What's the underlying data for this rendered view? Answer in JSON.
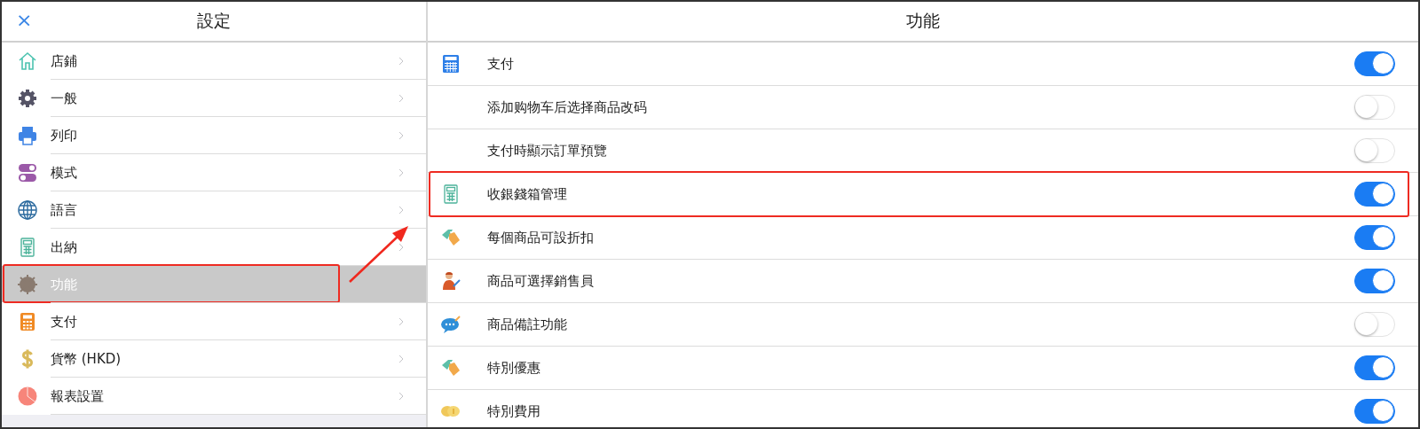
{
  "settings_panel": {
    "close": "×",
    "title": "設定",
    "items": [
      {
        "label": "店鋪",
        "selected": false,
        "outlined": false
      },
      {
        "label": "一般",
        "selected": false,
        "outlined": false
      },
      {
        "label": "列印",
        "selected": false,
        "outlined": false
      },
      {
        "label": "模式",
        "selected": false,
        "outlined": false
      },
      {
        "label": "語言",
        "selected": false,
        "outlined": false
      },
      {
        "label": "出納",
        "selected": false,
        "outlined": false
      },
      {
        "label": "功能",
        "selected": true,
        "outlined": true
      },
      {
        "label": "支付",
        "selected": false,
        "outlined": false
      },
      {
        "label": "貨幣 (HKD)",
        "selected": false,
        "outlined": false
      },
      {
        "label": "報表設置",
        "selected": false,
        "outlined": false
      }
    ]
  },
  "feature_panel": {
    "title": "功能",
    "rows": [
      {
        "label": "支付",
        "on": true,
        "outlined": false
      },
      {
        "label": "添加购物车后选择商品改码",
        "on": false,
        "outlined": false
      },
      {
        "label": "支付時顯示訂單預覽",
        "on": false,
        "outlined": false
      },
      {
        "label": "收銀錢箱管理",
        "on": true,
        "outlined": true
      },
      {
        "label": "每個商品可設折扣",
        "on": true,
        "outlined": false
      },
      {
        "label": "商品可選擇銷售員",
        "on": true,
        "outlined": false
      },
      {
        "label": "商品備註功能",
        "on": false,
        "outlined": false
      },
      {
        "label": "特別優惠",
        "on": true,
        "outlined": false
      },
      {
        "label": "特別費用",
        "on": true,
        "outlined": false
      }
    ]
  },
  "annotation_arrow": true
}
